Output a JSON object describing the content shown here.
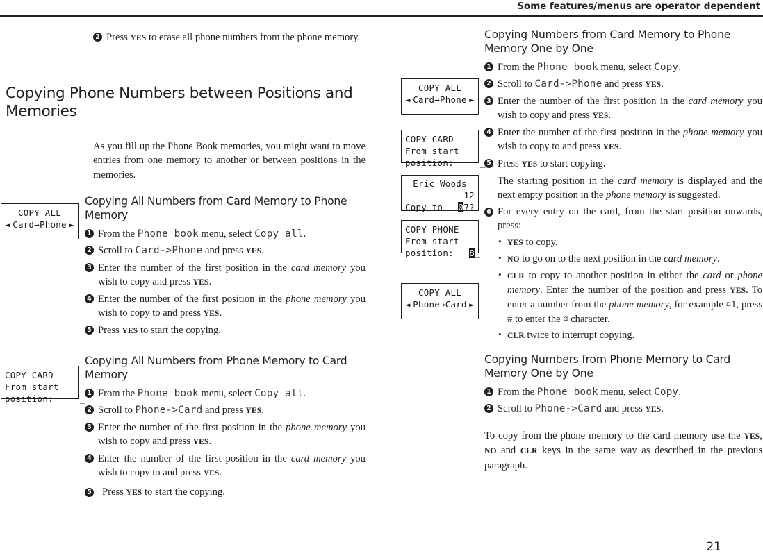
{
  "header": {
    "title": "Some features/menus are operator dependent",
    "page_number": "21"
  },
  "left_column": {
    "top_step": {
      "number": "2",
      "text_before_key": "Press ",
      "key": "YES",
      "text_after_key": " to erase all phone numbers from the phone memory."
    },
    "section_title": "Copying Phone Numbers between Positions and Memories",
    "intro_paragraph": "As you fill up the Phone Book memories, you might want to move entries from one memory to another or between positions in the memories.",
    "subsection_1": {
      "title": "Copying All Numbers from Card Memory to Phone Memory",
      "steps": [
        {
          "number": "1",
          "parts": [
            "From the ",
            "Phone book",
            " menu, select ",
            "Copy all",
            "."
          ]
        },
        {
          "number": "2",
          "parts": [
            "Scroll to ",
            "Card->Phone",
            " and press ",
            "YES",
            "."
          ]
        },
        {
          "number": "3",
          "parts": [
            "Enter the number of the first position in the ",
            "card memory",
            " you wish to copy and press ",
            "YES",
            "."
          ]
        },
        {
          "number": "4",
          "parts": [
            "Enter the number of the first position in the ",
            "phone memory",
            " you wish to copy to and press ",
            "YES",
            "."
          ]
        },
        {
          "number": "5",
          "parts": [
            "Press ",
            "YES",
            " to start the copying."
          ]
        }
      ]
    },
    "subsection_2": {
      "title": "Copying All Numbers from Phone Memory to Card Memory",
      "steps": [
        {
          "number": "1",
          "parts": [
            "From the ",
            "Phone book",
            " menu, select ",
            "Copy all",
            "."
          ]
        },
        {
          "number": "2",
          "parts": [
            "Scroll to ",
            "Phone->Card",
            " and press ",
            "YES",
            "."
          ]
        },
        {
          "number": "3",
          "parts": [
            "Enter the number of the first position in the ",
            "phone memory",
            " you wish to copy and press ",
            "YES",
            "."
          ]
        },
        {
          "number": "4",
          "parts": [
            "Enter the number of the first position in the ",
            "card memory",
            " you wish to copy to and press ",
            "YES",
            "."
          ]
        },
        {
          "number": "5",
          "parts": [
            "Press ",
            "YES",
            " to start the copying."
          ]
        }
      ]
    }
  },
  "right_column": {
    "subsection_1": {
      "title": "Copying Numbers from Card Memory to Phone Memory One by One",
      "steps": [
        {
          "number": "1",
          "parts": [
            "From the ",
            "Phone book",
            " menu, select ",
            "Copy",
            "."
          ]
        },
        {
          "number": "2",
          "parts": [
            "Scroll to ",
            "Card->Phone",
            " and press ",
            "YES",
            "."
          ]
        },
        {
          "number": "3",
          "parts": [
            "Enter the number of the first position in the ",
            "card memory",
            " you wish to copy and press ",
            "YES",
            "."
          ]
        },
        {
          "number": "4",
          "parts": [
            "Enter the number of the first position in the ",
            "phone memory",
            " you wish to copy to and press ",
            "YES",
            "."
          ]
        },
        {
          "number": "5",
          "parts": [
            "Press ",
            "YES",
            " to start copying."
          ]
        }
      ],
      "note_paragraph": {
        "parts": [
          "The starting position in the ",
          "card memory",
          " is displayed and the next empty position in the ",
          "phone memory",
          " is suggested."
        ]
      },
      "step_6": {
        "number": "6",
        "text": "For every entry on the card, from the start position onwards, press:"
      },
      "bullets": [
        {
          "key": "YES",
          "text": " to copy."
        },
        {
          "key": "NO",
          "text": " to go on to the next position in the ",
          "italic": "card memory",
          "tail": "."
        },
        {
          "key": "CLR",
          "text": " to copy to another position in either the ",
          "italic": "card",
          "mid": " or ",
          "italic2": "phone memory",
          "tail2": ". Enter the number of the position and press ",
          "key2": "YES",
          "tail3": ". To enter a number from the ",
          "italic3": "phone memory",
          "tail4": ", for example ¤1, press # to enter the ¤ character."
        },
        {
          "key": "CLR",
          "text": " twice to interrupt copying."
        }
      ]
    },
    "subsection_2": {
      "title": "Copying Numbers from Phone Memory to Card Memory One by One",
      "steps": [
        {
          "number": "1",
          "parts": [
            "From the ",
            "Phone book",
            " menu, select ",
            "Copy",
            "."
          ]
        },
        {
          "number": "2",
          "parts": [
            "Scroll to ",
            "Phone->Card",
            " and press ",
            "YES",
            "."
          ]
        }
      ],
      "closing_paragraph": {
        "parts": [
          "To copy from the phone memory to the card memory use the ",
          "YES",
          ", ",
          "NO",
          " and ",
          "CLR",
          " keys in the same way as described in the previous paragraph."
        ]
      }
    }
  },
  "lcd_displays": {
    "left_1": {
      "line1": "COPY ALL",
      "left_arrow": "◄",
      "line2": "Card→Phone",
      "right_arrow": "►"
    },
    "left_2": {
      "line1": "COPY CARD",
      "line2": "From start",
      "line3": "position:",
      "cursor": "_"
    },
    "mid_1": {
      "line1": "COPY ALL",
      "left_arrow": "◄",
      "line2": "Card→Phone",
      "right_arrow": "►"
    },
    "mid_2": {
      "line1": "COPY CARD",
      "line2": "From start",
      "line3": "position:",
      "cursor": "_"
    },
    "mid_3": {
      "line1": "Eric Woods",
      "line2": "12",
      "line3_label": "Copy to",
      "line3_value_inv": "0",
      "line3_value": "7?"
    },
    "mid_4": {
      "line1": "COPY PHONE",
      "line2": "From start",
      "line3": "position:",
      "line3_value_inv": "8",
      "cursor": "_"
    },
    "mid_5": {
      "line1": "COPY ALL",
      "left_arrow": "◄",
      "line2": "Phone→Card",
      "right_arrow": "►"
    }
  }
}
